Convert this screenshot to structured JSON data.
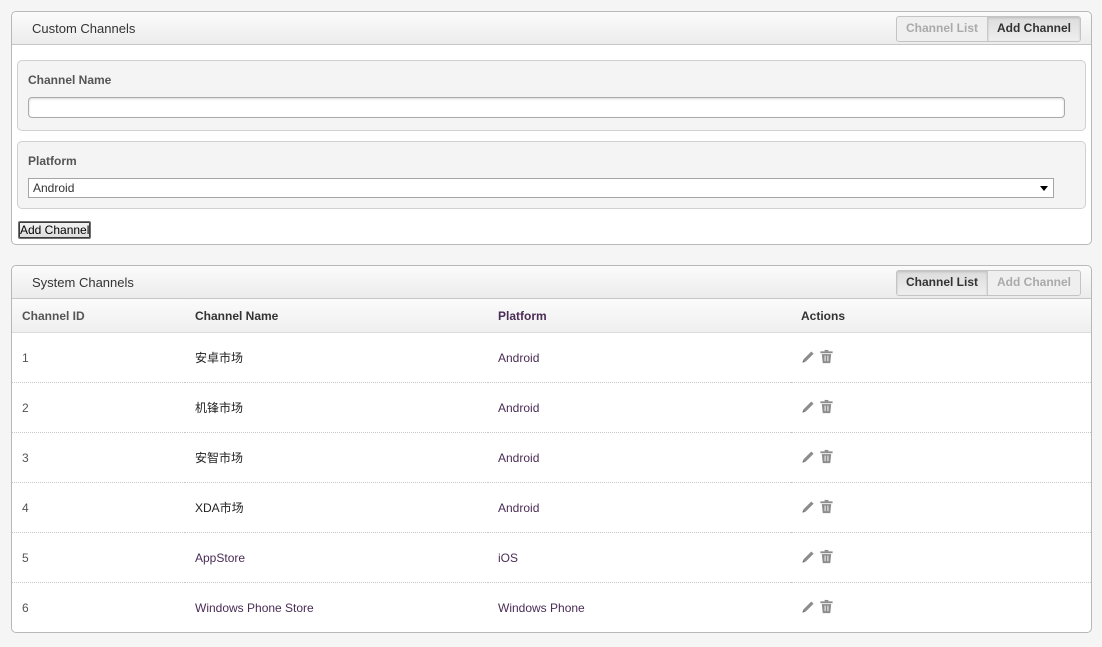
{
  "custom_panel": {
    "title": "Custom Channels",
    "tabs": [
      {
        "label": "Channel List",
        "active": false
      },
      {
        "label": "Add Channel",
        "active": true
      }
    ],
    "form": {
      "name_label": "Channel Name",
      "name_value": "",
      "platform_label": "Platform",
      "platform_value": "Android",
      "submit_label": "Add Channel"
    }
  },
  "system_panel": {
    "title": "System Channels",
    "tabs": [
      {
        "label": "Channel List",
        "active": true
      },
      {
        "label": "Add Channel",
        "active": false
      }
    ],
    "columns": [
      "Channel ID",
      "Channel Name",
      "Platform",
      "Actions"
    ],
    "rows": [
      {
        "id": "1",
        "name": "安卓市场",
        "platform": "Android",
        "actions": [
          "edit-icon",
          "trash-icon"
        ]
      },
      {
        "id": "2",
        "name": "机锋市场",
        "platform": "Android",
        "actions": [
          "edit-icon",
          "trash-icon"
        ]
      },
      {
        "id": "3",
        "name": "安智市场",
        "platform": "Android",
        "actions": [
          "edit-icon",
          "trash-icon"
        ]
      },
      {
        "id": "4",
        "name": "XDA市场",
        "platform": "Android",
        "actions": [
          "edit-icon",
          "trash-icon"
        ]
      },
      {
        "id": "5",
        "name": "AppStore",
        "platform": "iOS",
        "actions": [
          "edit-icon",
          "trash-icon"
        ]
      },
      {
        "id": "6",
        "name": "Windows Phone Store",
        "platform": "Windows Phone",
        "actions": [
          "edit-icon",
          "trash-icon"
        ]
      }
    ]
  },
  "colors": {
    "icon_gray": "#8c8c8c",
    "link_purple": "#4a2c55"
  }
}
